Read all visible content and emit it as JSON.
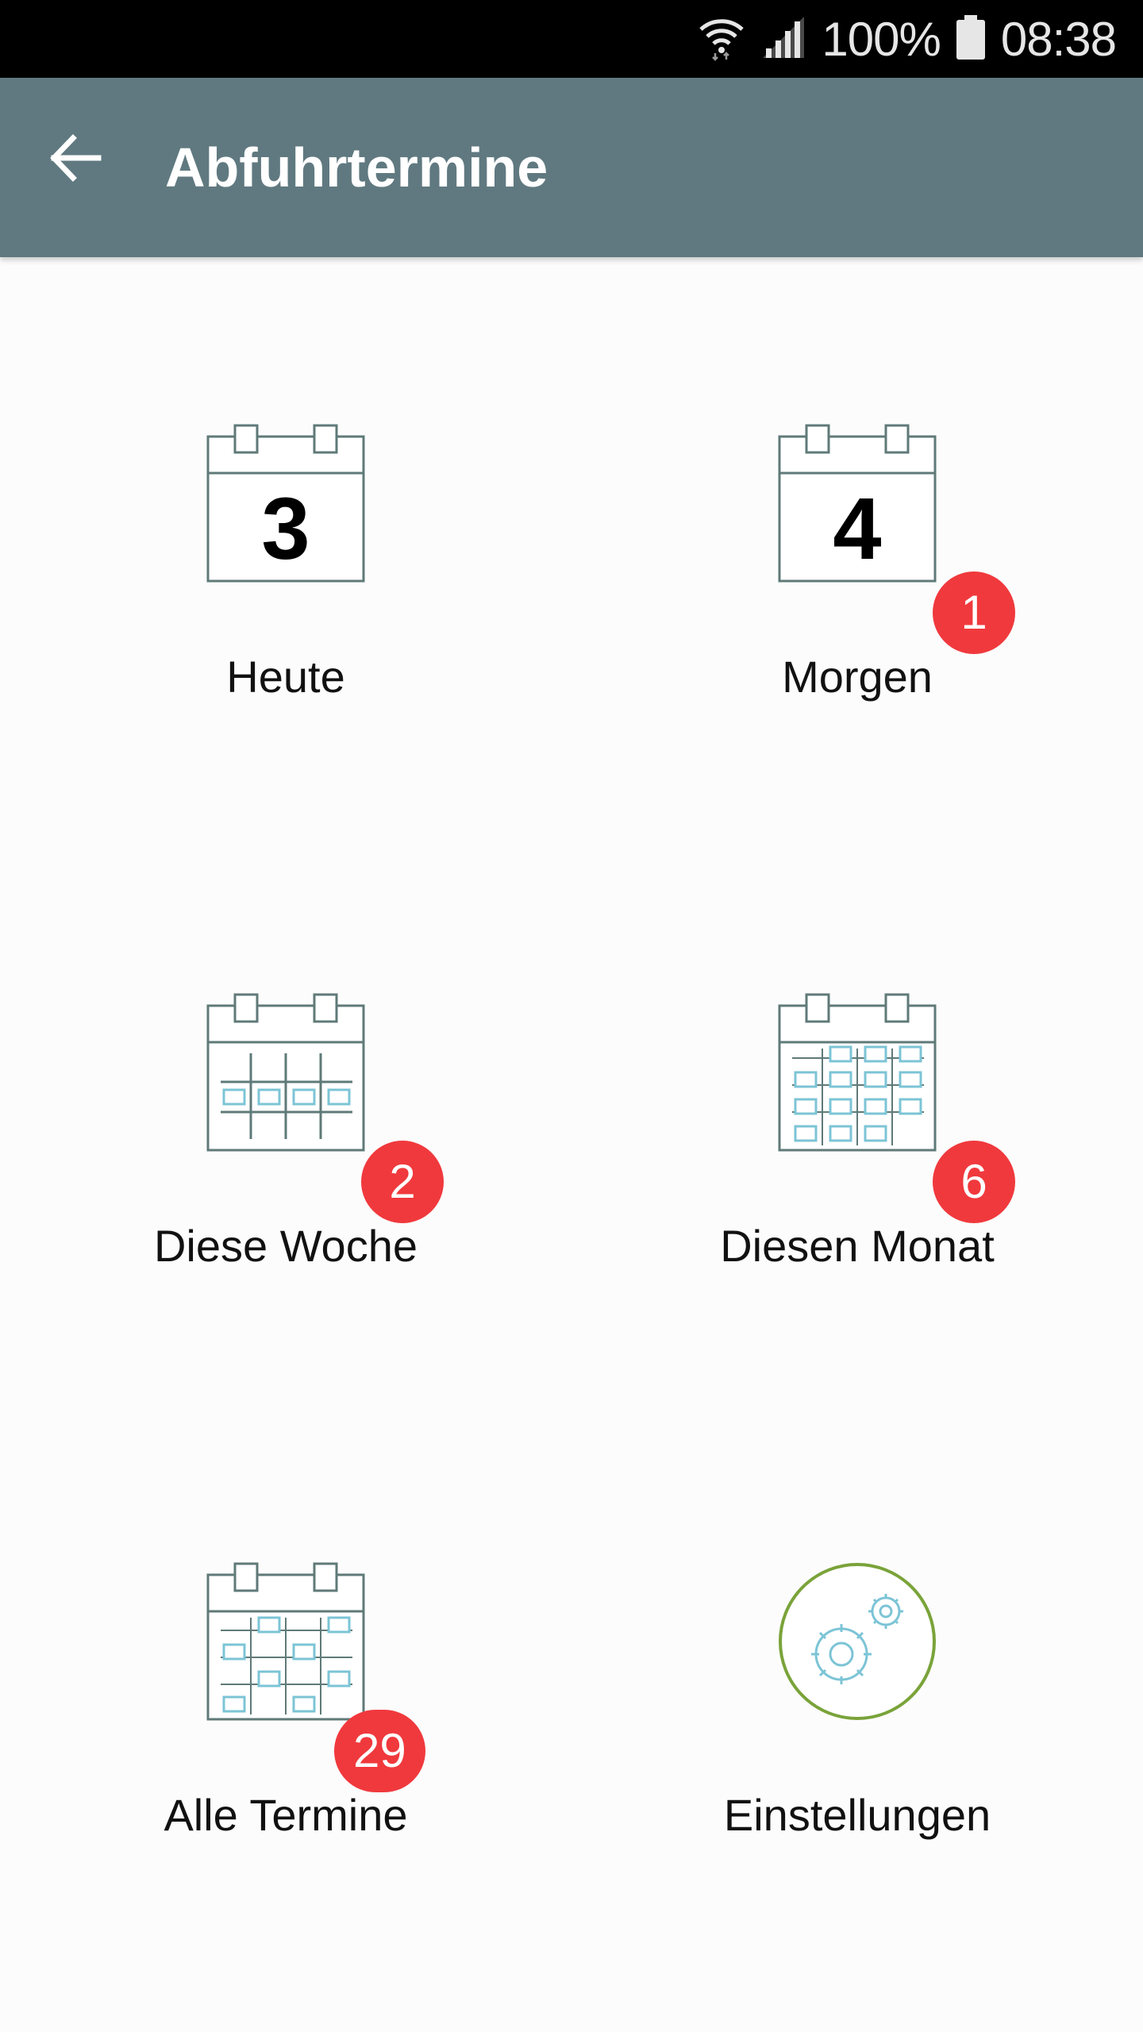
{
  "status_bar": {
    "battery": "100%",
    "time": "08:38"
  },
  "app_bar": {
    "title": "Abfuhrtermine",
    "back_icon": "arrow-left-icon"
  },
  "tiles": [
    {
      "label": "Heute",
      "icon": "calendar-day-icon",
      "day_number": "3",
      "badge": ""
    },
    {
      "label": "Morgen",
      "icon": "calendar-day-icon",
      "day_number": "4",
      "badge": "1"
    },
    {
      "label": "Diese Woche",
      "icon": "calendar-week-icon",
      "badge": "2"
    },
    {
      "label": "Diesen Monat",
      "icon": "calendar-month-icon",
      "badge": "6"
    },
    {
      "label": "Alle Termine",
      "icon": "calendar-all-icon",
      "badge": "29"
    },
    {
      "label": "Einstellungen",
      "icon": "settings-gears-icon",
      "badge": ""
    }
  ],
  "colors": {
    "app_bar": "#607980",
    "badge": "#f0393d",
    "calendar_stroke": "#5f7a78",
    "calendar_cell": "#7cc4d6",
    "settings_ring": "#7aa33a"
  }
}
